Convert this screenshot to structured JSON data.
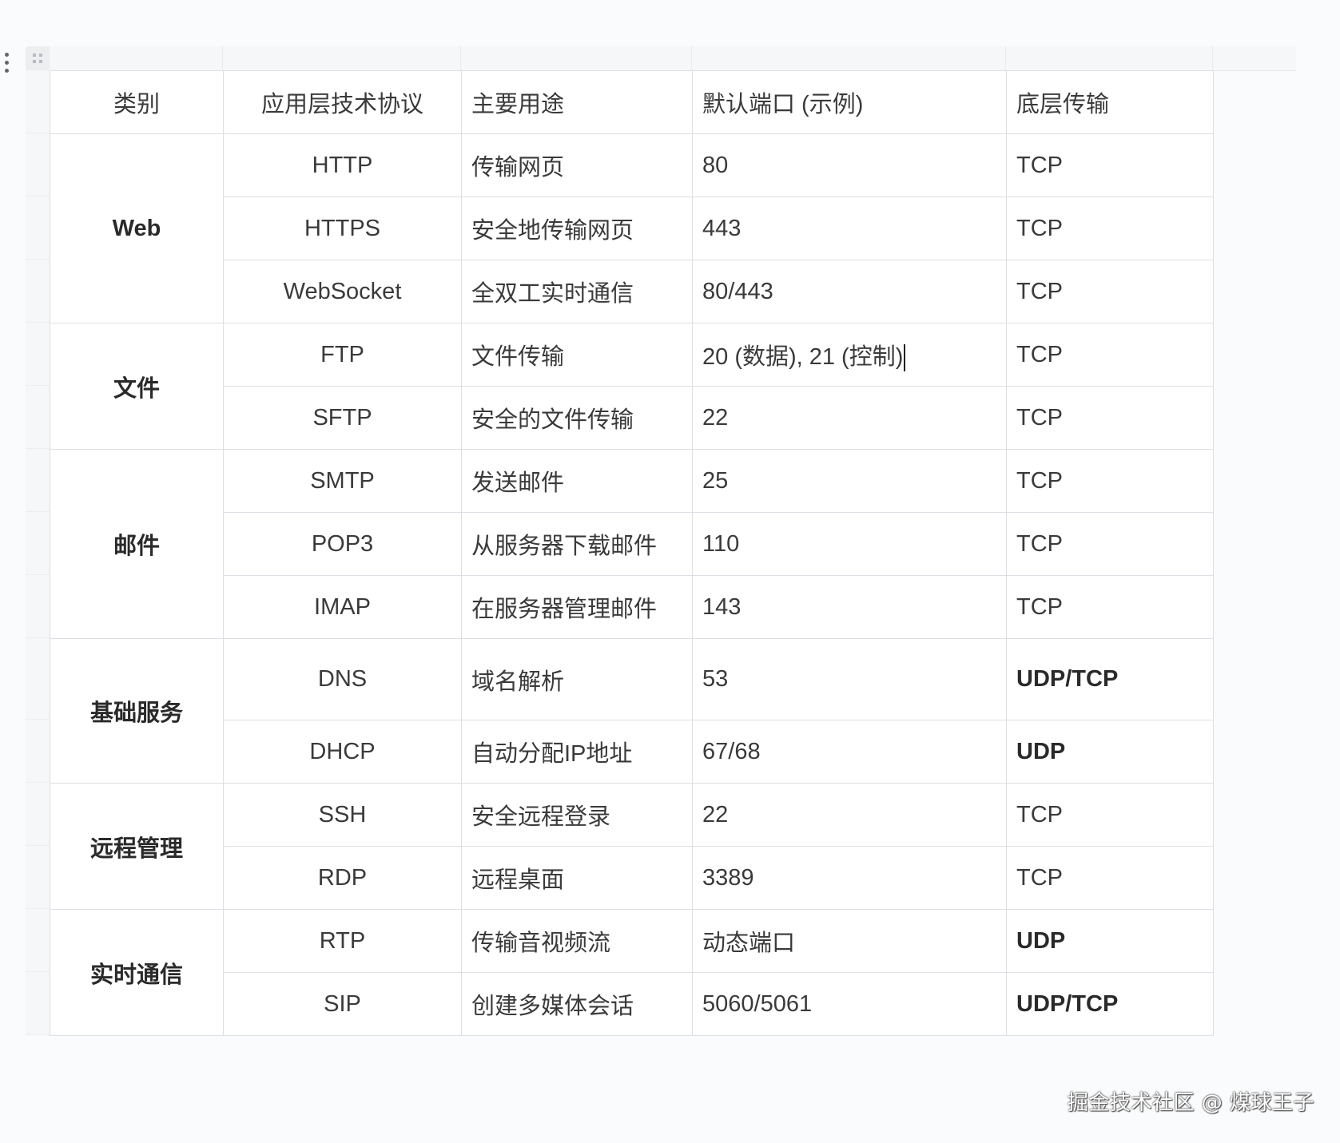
{
  "table": {
    "headers": [
      "类别",
      "应用层技术协议",
      "主要用途",
      "默认端口 (示例)",
      "底层传输"
    ],
    "groups": [
      {
        "category": "Web",
        "rows": [
          {
            "protocol": "HTTP",
            "usage": "传输网页",
            "port": "80",
            "transport": "TCP"
          },
          {
            "protocol": "HTTPS",
            "usage": "安全地传输网页",
            "port": "443",
            "transport": "TCP"
          },
          {
            "protocol": "WebSocket",
            "usage": "全双工实时通信",
            "port": "80/443",
            "transport": "TCP"
          }
        ]
      },
      {
        "category": "文件",
        "rows": [
          {
            "protocol": "FTP",
            "usage": "文件传输",
            "port": "20 (数据), 21 (控制)",
            "transport": "TCP"
          },
          {
            "protocol": "SFTP",
            "usage": "安全的文件传输",
            "port": "22",
            "transport": "TCP"
          }
        ]
      },
      {
        "category": "邮件",
        "rows": [
          {
            "protocol": "SMTP",
            "usage": "发送邮件",
            "port": "25",
            "transport": "TCP"
          },
          {
            "protocol": "POP3",
            "usage": "从服务器下载邮件",
            "port": "110",
            "transport": "TCP"
          },
          {
            "protocol": "IMAP",
            "usage": "在服务器管理邮件",
            "port": "143",
            "transport": "TCP"
          }
        ]
      },
      {
        "category": "基础服务",
        "rows": [
          {
            "protocol": "DNS",
            "usage": "域名解析",
            "port": "53",
            "transport": "UDP/TCP"
          },
          {
            "protocol": "DHCP",
            "usage": "自动分配IP地址",
            "port": "67/68",
            "transport": "UDP"
          }
        ]
      },
      {
        "category": "远程管理",
        "rows": [
          {
            "protocol": "SSH",
            "usage": "安全远程登录",
            "port": "22",
            "transport": "TCP"
          },
          {
            "protocol": "RDP",
            "usage": "远程桌面",
            "port": "3389",
            "transport": "TCP"
          }
        ]
      },
      {
        "category": "实时通信",
        "rows": [
          {
            "protocol": "RTP",
            "usage": "传输音视频流",
            "port": "动态端口",
            "transport": "UDP"
          },
          {
            "protocol": "SIP",
            "usage": "创建多媒体会话",
            "port": "5060/5061",
            "transport": "UDP/TCP"
          }
        ]
      }
    ]
  },
  "watermark": "掘金技术社区 @ 煤球王子",
  "icons": {
    "drag_handle": "drag-handle-icon",
    "table_grip": "table-grip-icon"
  }
}
